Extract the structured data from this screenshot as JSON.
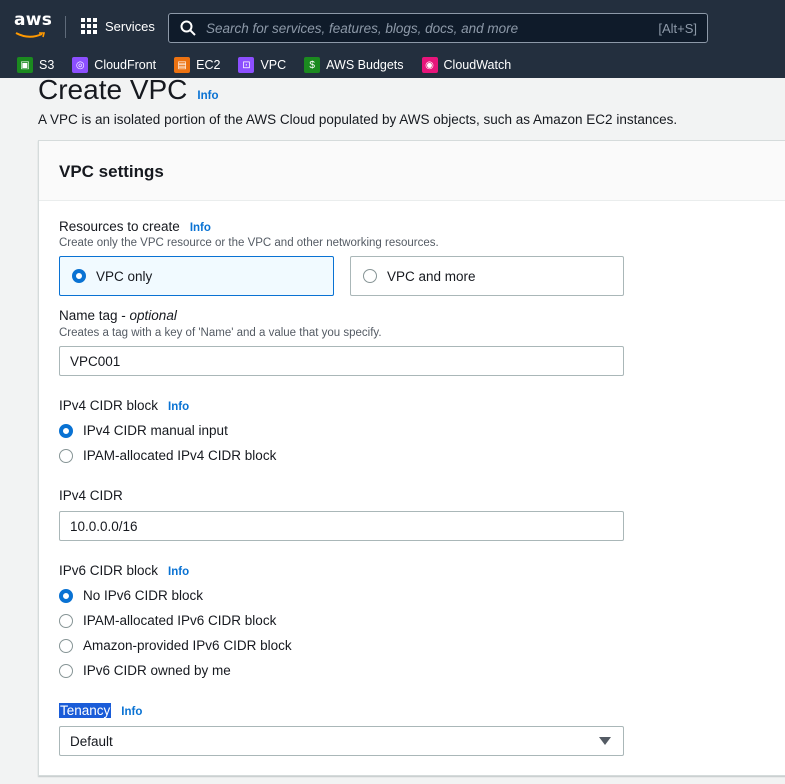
{
  "nav": {
    "logo": "aws",
    "services_label": "Services",
    "search_placeholder": "Search for services, features, blogs, docs, and more",
    "search_shortcut": "[Alt+S]"
  },
  "favorites": [
    {
      "label": "S3",
      "color": "#1b8a1f"
    },
    {
      "label": "CloudFront",
      "color": "#8c4fff"
    },
    {
      "label": "EC2",
      "color": "#ec7211"
    },
    {
      "label": "VPC",
      "color": "#8c4fff"
    },
    {
      "label": "AWS Budgets",
      "color": "#1b8a1f"
    },
    {
      "label": "CloudWatch",
      "color": "#e7157b"
    }
  ],
  "page": {
    "title": "Create VPC",
    "info": "Info",
    "description": "A VPC is an isolated portion of the AWS Cloud populated by AWS objects, such as Amazon EC2 instances."
  },
  "settings": {
    "header": "VPC settings",
    "resources": {
      "label": "Resources to create",
      "info": "Info",
      "description": "Create only the VPC resource or the VPC and other networking resources.",
      "options": [
        "VPC only",
        "VPC and more"
      ],
      "selected": "VPC only"
    },
    "name_tag": {
      "label": "Name tag - ",
      "optional": "optional",
      "description": "Creates a tag with a key of 'Name' and a value that you specify.",
      "value": "VPC001"
    },
    "ipv4_block": {
      "label": "IPv4 CIDR block",
      "info": "Info",
      "options": [
        "IPv4 CIDR manual input",
        "IPAM-allocated IPv4 CIDR block"
      ],
      "selected": "IPv4 CIDR manual input"
    },
    "ipv4_cidr": {
      "label": "IPv4 CIDR",
      "value": "10.0.0.0/16"
    },
    "ipv6_block": {
      "label": "IPv6 CIDR block",
      "info": "Info",
      "options": [
        "No IPv6 CIDR block",
        "IPAM-allocated IPv6 CIDR block",
        "Amazon-provided IPv6 CIDR block",
        "IPv6 CIDR owned by me"
      ],
      "selected": "No IPv6 CIDR block"
    },
    "tenancy": {
      "label": "Tenancy",
      "info": "Info",
      "value": "Default"
    }
  }
}
